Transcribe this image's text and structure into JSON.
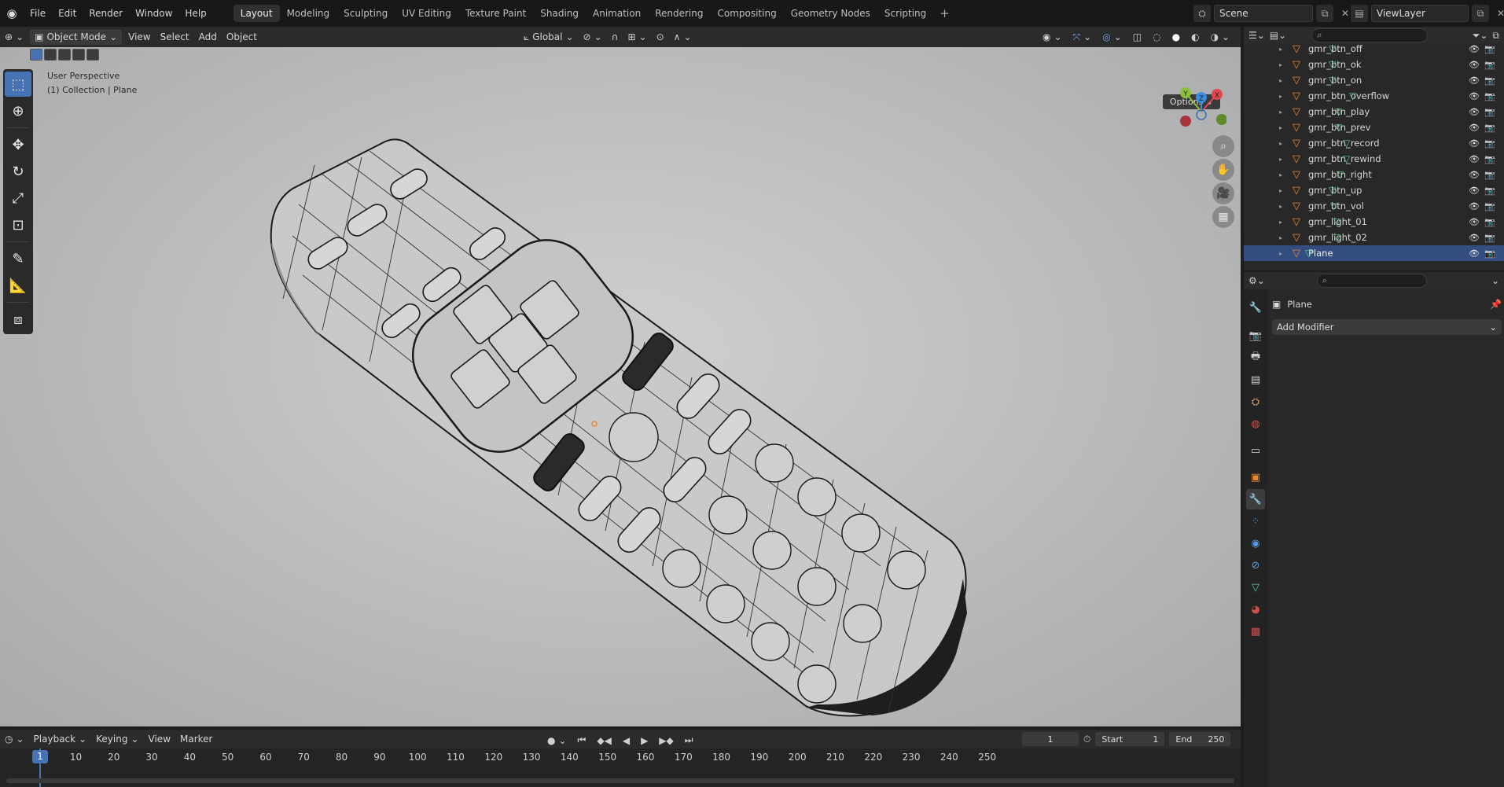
{
  "top_menu": [
    "File",
    "Edit",
    "Render",
    "Window",
    "Help"
  ],
  "workspaces": {
    "tabs": [
      "Layout",
      "Modeling",
      "Sculpting",
      "UV Editing",
      "Texture Paint",
      "Shading",
      "Animation",
      "Rendering",
      "Compositing",
      "Geometry Nodes",
      "Scripting"
    ],
    "active": "Layout",
    "add": "+"
  },
  "scene": {
    "name": "Scene",
    "view_layer": "ViewLayer"
  },
  "viewport_header": {
    "mode": "Object Mode",
    "menus": [
      "View",
      "Select",
      "Add",
      "Object"
    ],
    "transform_orientation": "Global"
  },
  "viewport": {
    "perspective_label": "User Perspective",
    "collection_label": "(1) Collection | Plane",
    "options_label": "Options",
    "gizmo_axes": {
      "x": "X",
      "y": "Y",
      "z": "Z"
    },
    "axis_colors": {
      "x": "#e2464f",
      "y": "#8ec03b",
      "z": "#3b8ee0"
    }
  },
  "toolbar": {
    "tools": [
      "select-box",
      "cursor",
      "move",
      "rotate",
      "scale",
      "transform",
      "annotate",
      "measure",
      "add-cube"
    ],
    "active": "select-box"
  },
  "timeline": {
    "menus": [
      "Playback",
      "Keying",
      "View",
      "Marker"
    ],
    "current_frame": "1",
    "start_label": "Start",
    "start": "1",
    "end_label": "End",
    "end": "250",
    "ruler": [
      "10",
      "20",
      "30",
      "40",
      "50",
      "60",
      "70",
      "80",
      "90",
      "100",
      "110",
      "120",
      "130",
      "140",
      "150",
      "160",
      "170",
      "180",
      "190",
      "200",
      "210",
      "220",
      "230",
      "240",
      "250"
    ]
  },
  "outliner": {
    "items": [
      {
        "name": "gmr_btn_off",
        "selected": false
      },
      {
        "name": "gmr_btn_ok",
        "selected": false
      },
      {
        "name": "gmr_btn_on",
        "selected": false
      },
      {
        "name": "gmr_btn_overflow",
        "selected": false
      },
      {
        "name": "gmr_btn_play",
        "selected": false
      },
      {
        "name": "gmr_btn_prev",
        "selected": false
      },
      {
        "name": "gmr_btn_record",
        "selected": false
      },
      {
        "name": "gmr_btn_rewind",
        "selected": false
      },
      {
        "name": "gmr_btn_right",
        "selected": false
      },
      {
        "name": "gmr_btn_up",
        "selected": false
      },
      {
        "name": "gmr_btn_vol",
        "selected": false
      },
      {
        "name": "gmr_light_01",
        "selected": false
      },
      {
        "name": "gmr_light_02",
        "selected": false
      },
      {
        "name": "Plane",
        "selected": true
      }
    ]
  },
  "properties": {
    "object_name": "Plane",
    "add_modifier_label": "Add Modifier",
    "active_tab": "modifiers"
  },
  "colors": {
    "accent": "#4772b3",
    "selection": "#334d80",
    "object_orange": "#e8892f",
    "mesh_green": "#57c98a"
  }
}
